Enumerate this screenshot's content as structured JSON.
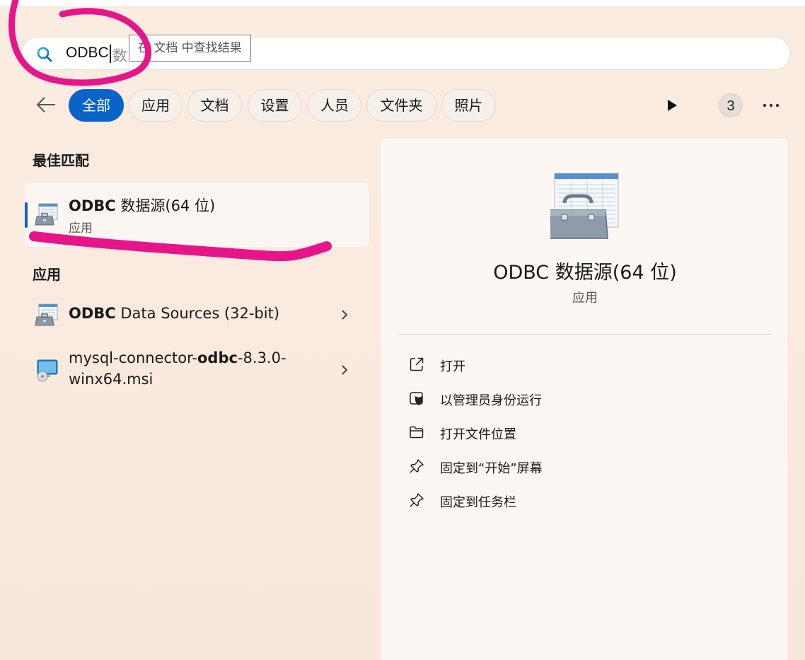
{
  "search": {
    "query": "ODBC",
    "ghost_text": "数",
    "tooltip": "在 文档 中查找结果"
  },
  "filters": {
    "chips": [
      "全部",
      "应用",
      "文档",
      "设置",
      "人员",
      "文件夹",
      "照片"
    ],
    "active_index": 0,
    "count": "3"
  },
  "best_match": {
    "section_label": "最佳匹配",
    "title_bold": "ODBC",
    "title_rest": " 数据源(64 位)",
    "subtitle": "应用",
    "icon": "toolbox-icon"
  },
  "apps": {
    "section_label": "应用",
    "items": [
      {
        "title_bold": "ODBC",
        "title_rest": " Data Sources (32-bit)",
        "icon": "toolbox-icon"
      },
      {
        "line1_pre": "mysql-connector-",
        "line1_bold": "odbc",
        "line1_post": "-8.3.0-",
        "line2": "winx64.msi",
        "icon": "installer-icon"
      }
    ]
  },
  "detail": {
    "title": "ODBC 数据源(64 位)",
    "subtitle": "应用",
    "actions": [
      {
        "label": "打开",
        "icon": "open-external-icon"
      },
      {
        "label": "以管理员身份运行",
        "icon": "shield-admin-icon"
      },
      {
        "label": "打开文件位置",
        "icon": "folder-icon"
      },
      {
        "label": "固定到“开始”屏幕",
        "icon": "pin-icon"
      },
      {
        "label": "固定到任务栏",
        "icon": "pin-icon"
      }
    ]
  },
  "colors": {
    "accent": "#0a63c9",
    "annotation": "#e6158a"
  }
}
